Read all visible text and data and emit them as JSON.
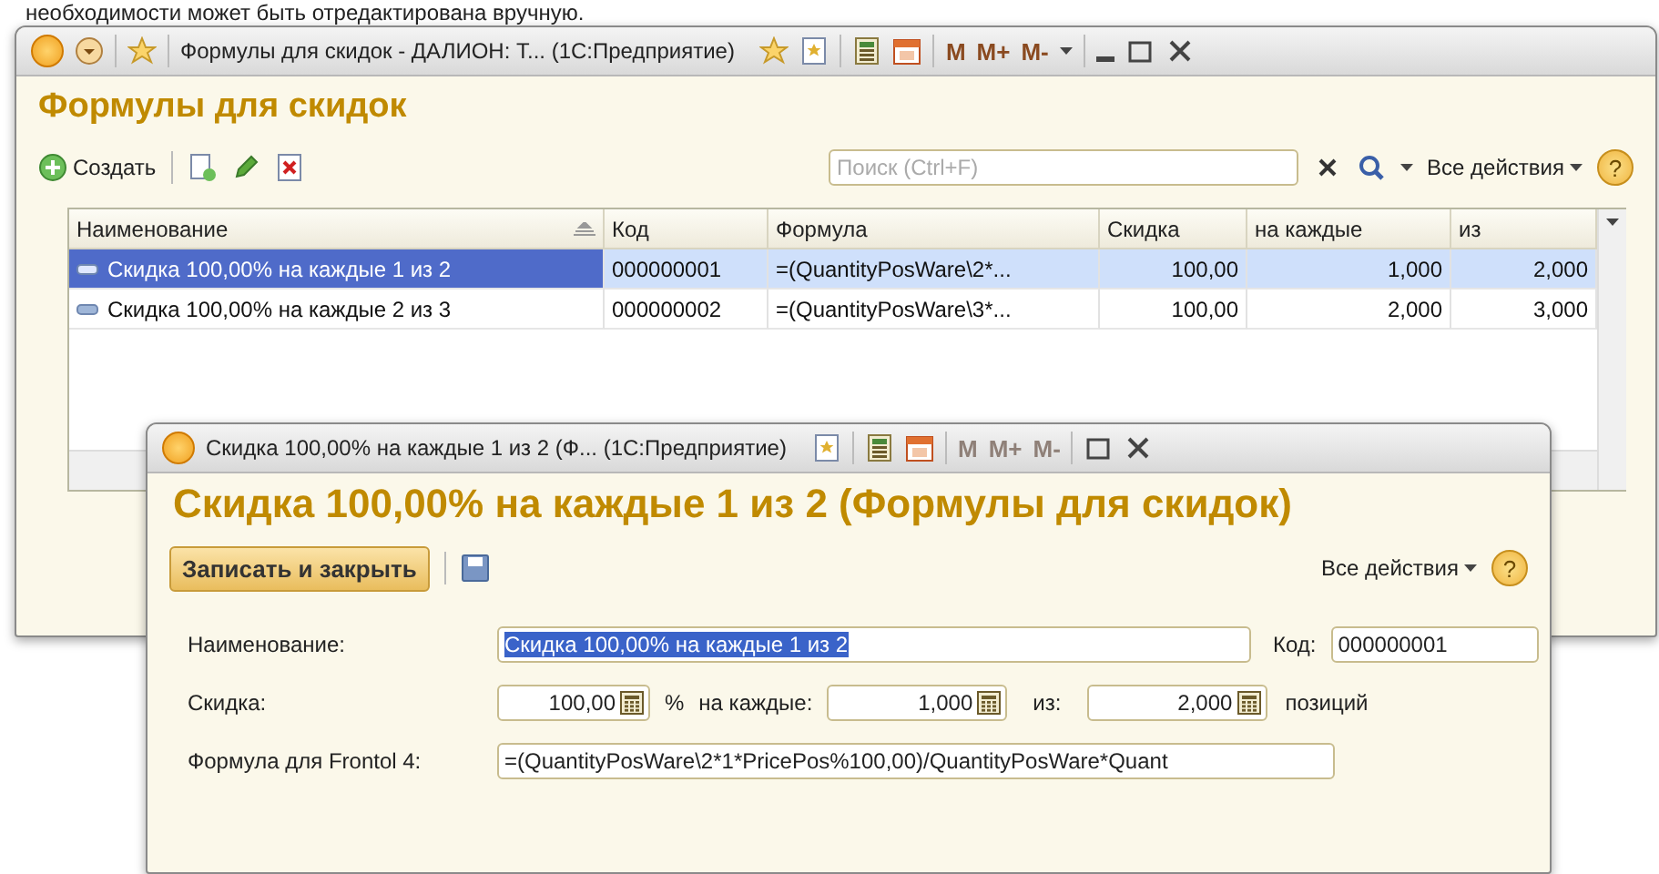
{
  "doc_text": "необходимости может быть отредактирована вручную.",
  "main_window": {
    "title": "Формулы для скидок - ДАЛИОН: Т...  (1С:Предприятие)",
    "memory_buttons": [
      {
        "label": "M",
        "disabled": false
      },
      {
        "label": "M+",
        "disabled": false
      },
      {
        "label": "M-",
        "disabled": false
      }
    ],
    "heading": "Формулы для скидок",
    "create_button": "Создать",
    "search": {
      "placeholder": "Поиск (Ctrl+F)"
    },
    "all_actions": "Все действия",
    "help": "?",
    "table": {
      "columns": [
        "Наименование",
        "Код",
        "Формула",
        "Скидка",
        "на каждые",
        "из"
      ],
      "rows": [
        {
          "cells": [
            "Скидка 100,00% на каждые 1 из 2",
            "000000001",
            "=(QuantityPosWare\\2*...",
            "100,00",
            "1,000",
            "2,000"
          ],
          "selected": true
        },
        {
          "cells": [
            "Скидка 100,00% на каждые 2 из 3",
            "000000002",
            "=(QuantityPosWare\\3*...",
            "100,00",
            "2,000",
            "3,000"
          ],
          "selected": false
        }
      ]
    }
  },
  "item_window": {
    "title": "Скидка 100,00% на каждые 1 из 2 (Ф...  (1С:Предприятие)",
    "memory_buttons": [
      {
        "label": "M",
        "disabled": true
      },
      {
        "label": "M+",
        "disabled": true
      },
      {
        "label": "M-",
        "disabled": true
      }
    ],
    "heading": "Скидка 100,00% на каждые 1 из 2 (Формулы для скидок)",
    "save_close_button": "Записать и закрыть",
    "all_actions": "Все действия",
    "help": "?",
    "name_label": "Наименование:",
    "name_value": "Скидка 100,00% на каждые 1 из 2",
    "name_value_highlighted": true,
    "code_label": "Код:",
    "code_value": "000000001",
    "discount_label": "Скидка:",
    "discount_value": "100,00",
    "percent": "%",
    "each_label": "на каждые:",
    "each_value": "1,000",
    "of_label": "из:",
    "of_value": "2,000",
    "positions": "позиций",
    "formula_label": "Формула для Frontol 4:",
    "formula_value": "=(QuantityPosWare\\2*1*PricePos%100,00)/QuantityPosWare*Quant"
  }
}
